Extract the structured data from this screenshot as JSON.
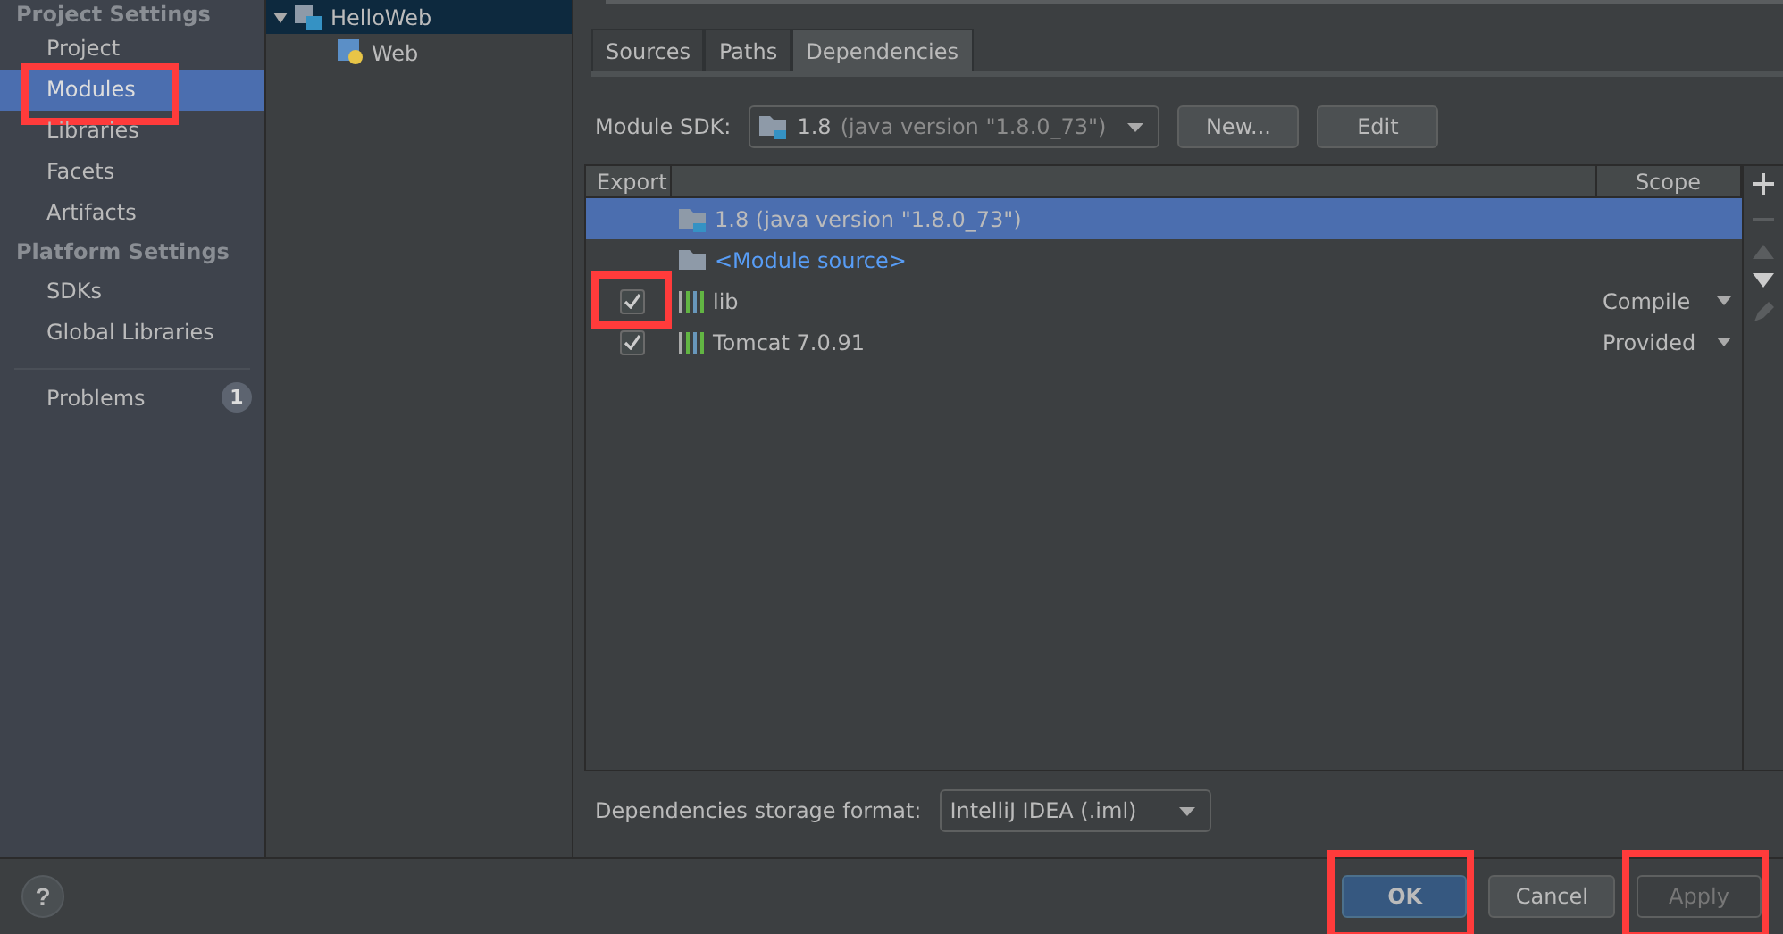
{
  "sidebar": {
    "sections": [
      {
        "title": "Project Settings",
        "items": [
          {
            "label": "Project",
            "selected": false,
            "highlighted": false
          },
          {
            "label": "Modules",
            "selected": true,
            "highlighted": true
          },
          {
            "label": "Libraries",
            "selected": false,
            "highlighted": false
          },
          {
            "label": "Facets",
            "selected": false,
            "highlighted": false
          },
          {
            "label": "Artifacts",
            "selected": false,
            "highlighted": false
          }
        ]
      },
      {
        "title": "Platform Settings",
        "items": [
          {
            "label": "SDKs",
            "selected": false,
            "highlighted": false
          },
          {
            "label": "Global Libraries",
            "selected": false,
            "highlighted": false
          }
        ]
      }
    ],
    "problems": {
      "label": "Problems",
      "count": "1"
    }
  },
  "tree": {
    "label": "HelloWeb",
    "selected": true,
    "expanded": true,
    "children": [
      {
        "label": "Web",
        "selected": false
      }
    ]
  },
  "tabs": [
    {
      "label": "Sources",
      "selected": false
    },
    {
      "label": "Paths",
      "selected": false
    },
    {
      "label": "Dependencies",
      "selected": true
    }
  ],
  "module_sdk": {
    "label": "Module SDK:",
    "value": "1.8",
    "detail": "(java version \"1.8.0_73\")",
    "buttons": [
      "New...",
      "Edit"
    ]
  },
  "dependencies": {
    "columns": [
      "Export",
      "Scope"
    ],
    "rows": [
      {
        "kind": "sdk",
        "name": "1.8",
        "detail": "(java version \"1.8.0_73\")",
        "selected": true
      },
      {
        "kind": "source",
        "name": "<Module source>",
        "selected": false
      },
      {
        "kind": "library",
        "name": "lib",
        "checked": true,
        "highlighted": true,
        "scope": "Compile",
        "selected": false
      },
      {
        "kind": "library",
        "name": "Tomcat 7.0.91",
        "checked": true,
        "highlighted": false,
        "scope": "Provided",
        "selected": false
      }
    ]
  },
  "storage_format": {
    "label": "Dependencies storage format:",
    "value": "IntelliJ IDEA (.iml)"
  },
  "footer": {
    "help": "?",
    "buttons": [
      {
        "label": "OK",
        "kind": "primary",
        "disabled": false,
        "highlighted": true
      },
      {
        "label": "Cancel",
        "kind": "normal",
        "disabled": false,
        "highlighted": false
      },
      {
        "label": "Apply",
        "kind": "normal",
        "disabled": true,
        "highlighted": true
      }
    ]
  }
}
